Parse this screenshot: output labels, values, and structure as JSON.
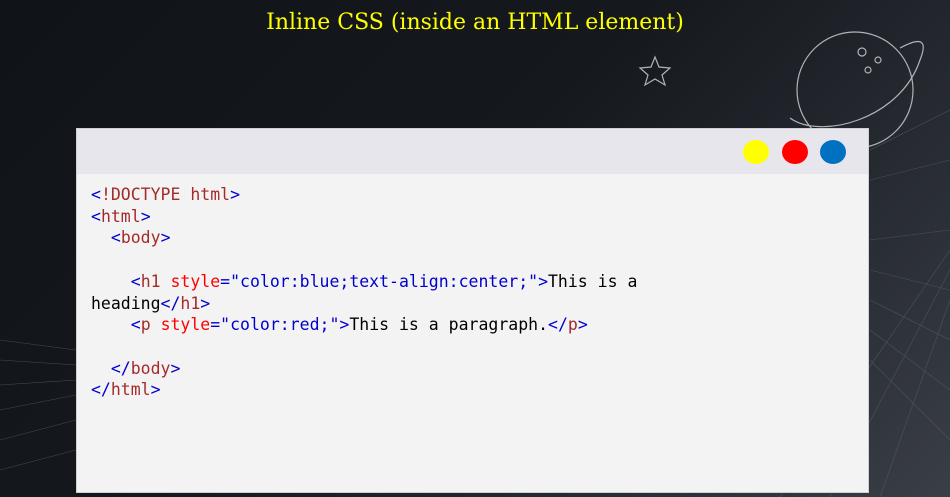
{
  "title": "Inline CSS (inside an HTML element)",
  "window": {
    "dots": [
      "yellow",
      "red",
      "blue"
    ],
    "colors": {
      "yellow": "#ffff00",
      "red": "#ff0000",
      "blue": "#0070c0"
    }
  },
  "code": {
    "doctype_keyword": "!DOCTYPE",
    "doctype_value": "html",
    "html_tag": "html",
    "body_tag": "body",
    "h1_tag": "h1",
    "h1_style_attr": "style",
    "h1_style_value": "\"color:blue;text-align:center;\"",
    "h1_text_line1": "This is a",
    "h1_text_line2": "heading",
    "p_tag": "p",
    "p_style_attr": "style",
    "p_style_value": "\"color:red;\"",
    "p_text": "This is a paragraph."
  }
}
